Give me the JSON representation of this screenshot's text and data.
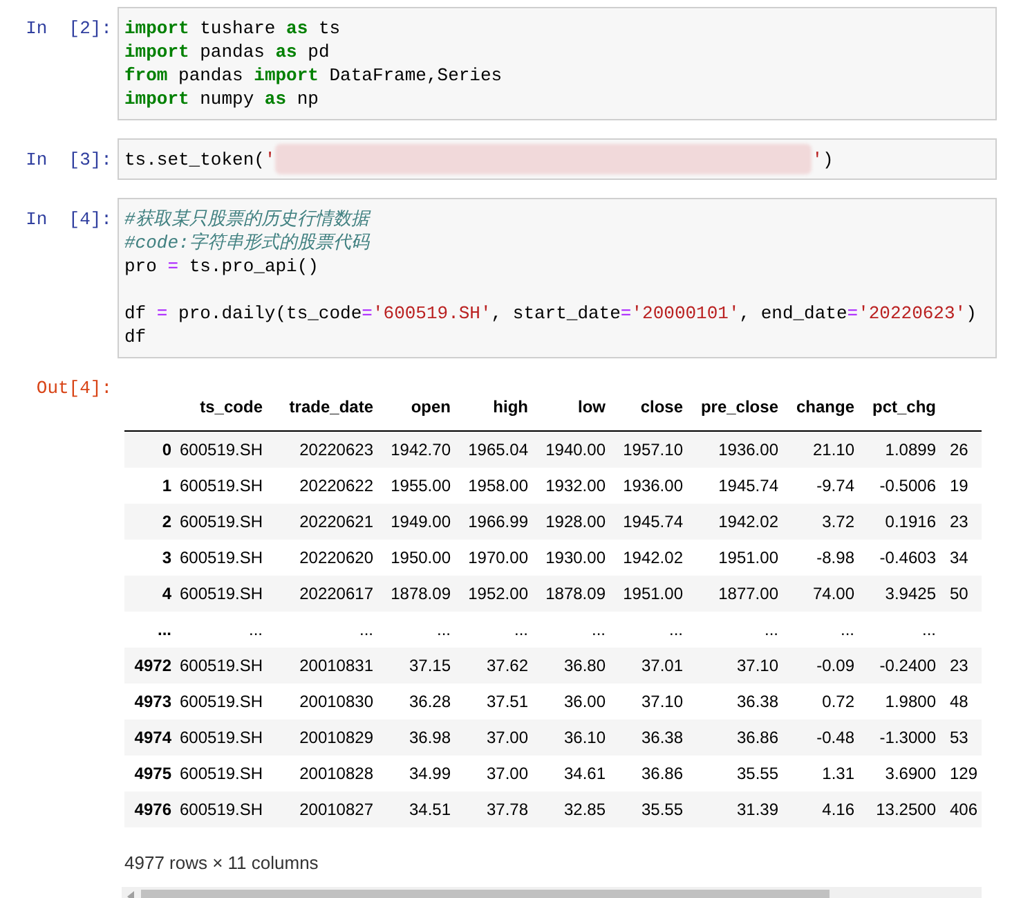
{
  "cells": [
    {
      "prompt": "In  [2]:",
      "lines": [
        {
          "tokens": [
            {
              "kind": "keyword",
              "text": "import"
            },
            {
              "kind": "plain",
              "text": " tushare "
            },
            {
              "kind": "keyword",
              "text": "as"
            },
            {
              "kind": "plain",
              "text": " ts"
            }
          ]
        },
        {
          "tokens": [
            {
              "kind": "keyword",
              "text": "import"
            },
            {
              "kind": "plain",
              "text": " pandas "
            },
            {
              "kind": "keyword",
              "text": "as"
            },
            {
              "kind": "plain",
              "text": " pd"
            }
          ]
        },
        {
          "tokens": [
            {
              "kind": "keyword",
              "text": "from"
            },
            {
              "kind": "plain",
              "text": " pandas "
            },
            {
              "kind": "keyword",
              "text": "import"
            },
            {
              "kind": "plain",
              "text": " DataFrame,Series"
            }
          ]
        },
        {
          "tokens": [
            {
              "kind": "keyword",
              "text": "import"
            },
            {
              "kind": "plain",
              "text": " numpy "
            },
            {
              "kind": "keyword",
              "text": "as"
            },
            {
              "kind": "plain",
              "text": " np"
            }
          ]
        }
      ]
    },
    {
      "prompt": "In  [3]:",
      "lines": [
        {
          "tokens": [
            {
              "kind": "plain",
              "text": "ts.set_token("
            },
            {
              "kind": "string",
              "text": "'"
            },
            {
              "kind": "redaction"
            },
            {
              "kind": "string",
              "text": "'"
            },
            {
              "kind": "plain",
              "text": ")"
            }
          ]
        }
      ]
    },
    {
      "prompt": "In  [4]:",
      "lines": [
        {
          "tokens": [
            {
              "kind": "comment",
              "text": "#获取某只股票的历史行情数据"
            }
          ]
        },
        {
          "tokens": [
            {
              "kind": "comment",
              "text": "#code:字符串形式的股票代码"
            }
          ]
        },
        {
          "tokens": [
            {
              "kind": "plain",
              "text": "pro "
            },
            {
              "kind": "operator",
              "text": "="
            },
            {
              "kind": "plain",
              "text": " ts.pro_api()"
            }
          ]
        },
        {
          "blank_before": true,
          "tokens": [
            {
              "kind": "plain",
              "text": "df "
            },
            {
              "kind": "operator",
              "text": "="
            },
            {
              "kind": "plain",
              "text": " pro.daily(ts_code"
            },
            {
              "kind": "operator",
              "text": "="
            },
            {
              "kind": "string",
              "text": "'600519.SH'"
            },
            {
              "kind": "plain",
              "text": ", start_date"
            },
            {
              "kind": "operator",
              "text": "="
            },
            {
              "kind": "string",
              "text": "'20000101'"
            },
            {
              "kind": "plain",
              "text": ", end_date"
            },
            {
              "kind": "operator",
              "text": "="
            },
            {
              "kind": "string",
              "text": "'20220623'"
            },
            {
              "kind": "plain",
              "text": ")"
            }
          ]
        },
        {
          "tokens": [
            {
              "kind": "plain",
              "text": "df"
            }
          ]
        }
      ]
    }
  ],
  "output": {
    "prompt": "Out[4]:",
    "columns": [
      "ts_code",
      "trade_date",
      "open",
      "high",
      "low",
      "close",
      "pre_close",
      "change",
      "pct_chg"
    ],
    "rows": [
      {
        "index": "0",
        "cells": [
          "600519.SH",
          "20220623",
          "1942.70",
          "1965.04",
          "1940.00",
          "1957.10",
          "1936.00",
          "21.10",
          "1.0899",
          "26"
        ]
      },
      {
        "index": "1",
        "cells": [
          "600519.SH",
          "20220622",
          "1955.00",
          "1958.00",
          "1932.00",
          "1936.00",
          "1945.74",
          "-9.74",
          "-0.5006",
          "19"
        ]
      },
      {
        "index": "2",
        "cells": [
          "600519.SH",
          "20220621",
          "1949.00",
          "1966.99",
          "1928.00",
          "1945.74",
          "1942.02",
          "3.72",
          "0.1916",
          "23"
        ]
      },
      {
        "index": "3",
        "cells": [
          "600519.SH",
          "20220620",
          "1950.00",
          "1970.00",
          "1930.00",
          "1942.02",
          "1951.00",
          "-8.98",
          "-0.4603",
          "34"
        ]
      },
      {
        "index": "4",
        "cells": [
          "600519.SH",
          "20220617",
          "1878.09",
          "1952.00",
          "1878.09",
          "1951.00",
          "1877.00",
          "74.00",
          "3.9425",
          "50"
        ]
      },
      {
        "index": "...",
        "cells": [
          "...",
          "...",
          "...",
          "...",
          "...",
          "...",
          "...",
          "...",
          "..."
        ]
      },
      {
        "index": "4972",
        "cells": [
          "600519.SH",
          "20010831",
          "37.15",
          "37.62",
          "36.80",
          "37.01",
          "37.10",
          "-0.09",
          "-0.2400",
          "23"
        ]
      },
      {
        "index": "4973",
        "cells": [
          "600519.SH",
          "20010830",
          "36.28",
          "37.51",
          "36.00",
          "37.10",
          "36.38",
          "0.72",
          "1.9800",
          "48"
        ]
      },
      {
        "index": "4974",
        "cells": [
          "600519.SH",
          "20010829",
          "36.98",
          "37.00",
          "36.10",
          "36.38",
          "36.86",
          "-0.48",
          "-1.3000",
          "53"
        ]
      },
      {
        "index": "4975",
        "cells": [
          "600519.SH",
          "20010828",
          "34.99",
          "37.00",
          "34.61",
          "36.86",
          "35.55",
          "1.31",
          "3.6900",
          "129"
        ]
      },
      {
        "index": "4976",
        "cells": [
          "600519.SH",
          "20010827",
          "34.51",
          "37.78",
          "32.85",
          "35.55",
          "31.39",
          "4.16",
          "13.2500",
          "406"
        ]
      }
    ],
    "summary": "4977 rows × 11 columns"
  }
}
